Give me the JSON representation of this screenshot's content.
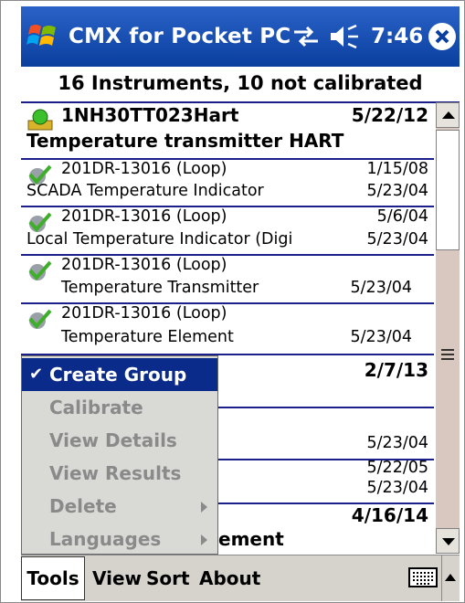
{
  "titlebar": {
    "app_title": "CMX for Pocket PC",
    "time": "7:46"
  },
  "header": {
    "summary": "16 Instruments, 10 not calibrated"
  },
  "list": {
    "items": [
      {
        "name": "1NH30TT023Hart",
        "description": "Temperature transmitter HART",
        "date": "5/22/12",
        "date2": ""
      },
      {
        "name": "201DR-13016 (Loop)",
        "description": "SCADA Temperature Indicator",
        "date": "1/15/08",
        "date2": "5/23/04"
      },
      {
        "name": "201DR-13016 (Loop)",
        "description": "Local Temperature Indicator (Digi",
        "date": "5/6/04",
        "date2": "5/23/04"
      },
      {
        "name": "201DR-13016 (Loop)",
        "description": "Temperature Transmitter",
        "date": "",
        "date2": "5/23/04"
      },
      {
        "name": "201DR-13016 (Loop)",
        "description": "Temperature Element",
        "date": "",
        "date2": "5/23/04"
      },
      {
        "name": "",
        "description": "",
        "date": "2/7/13",
        "date2": ""
      },
      {
        "name": "",
        "description": "",
        "date": "",
        "date2": "5/23/04"
      },
      {
        "name": "",
        "description": "",
        "date": "5/22/05",
        "date2": "5/23/04"
      },
      {
        "name": "",
        "description": "ement",
        "date": "4/16/14",
        "date2": ""
      }
    ]
  },
  "context_menu": {
    "items": [
      {
        "label": "Create Group",
        "checked": true
      },
      {
        "label": "Calibrate"
      },
      {
        "label": "View Details"
      },
      {
        "label": "View Results"
      },
      {
        "label": "Delete",
        "submenu": true
      },
      {
        "label": "Languages",
        "submenu": true
      }
    ]
  },
  "menubar": {
    "tools": "Tools",
    "view": "View",
    "sort": "Sort",
    "about": "About"
  },
  "colors": {
    "title_bar": "#1a4fb6",
    "menu_highlight": "#0a2b8a",
    "divider": "#1a1f8a",
    "disabled_text": "#8a8a8a"
  }
}
